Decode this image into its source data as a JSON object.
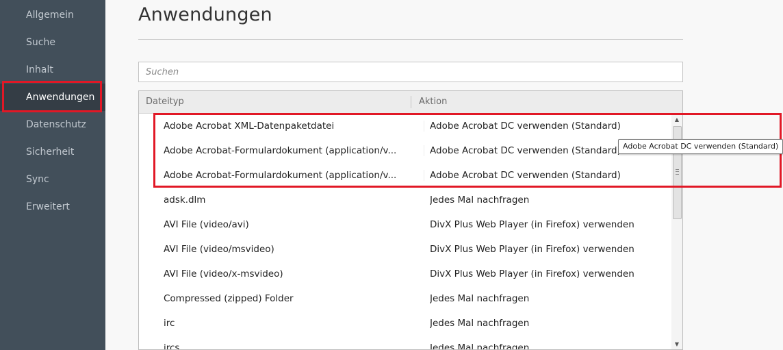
{
  "sidebar": {
    "items": [
      {
        "label": "Allgemein"
      },
      {
        "label": "Suche"
      },
      {
        "label": "Inhalt"
      },
      {
        "label": "Anwendungen"
      },
      {
        "label": "Datenschutz"
      },
      {
        "label": "Sicherheit"
      },
      {
        "label": "Sync"
      },
      {
        "label": "Erweitert"
      }
    ],
    "active": "Anwendungen"
  },
  "main": {
    "title": "Anwendungen",
    "search": {
      "placeholder": "Suchen",
      "value": ""
    },
    "table": {
      "columns": [
        "Dateityp",
        "Aktion"
      ],
      "rows": [
        {
          "type": "Adobe Acrobat XML-Datenpaketdatei",
          "action": "Adobe Acrobat DC  verwenden (Standard)"
        },
        {
          "type": "Adobe Acrobat-Formulardokument (application/v...",
          "action": "Adobe Acrobat DC  verwenden (Standard)"
        },
        {
          "type": "Adobe Acrobat-Formulardokument (application/v...",
          "action": "Adobe Acrobat DC  verwenden (Standard)"
        },
        {
          "type": "adsk.dlm",
          "action": "Jedes Mal nachfragen"
        },
        {
          "type": "AVI File (video/avi)",
          "action": "DivX Plus Web Player (in Firefox) verwenden"
        },
        {
          "type": "AVI File (video/msvideo)",
          "action": "DivX Plus Web Player (in Firefox) verwenden"
        },
        {
          "type": "AVI File (video/x-msvideo)",
          "action": "DivX Plus Web Player (in Firefox) verwenden"
        },
        {
          "type": "Compressed (zipped) Folder",
          "action": "Jedes Mal nachfragen"
        },
        {
          "type": "irc",
          "action": "Jedes Mal nachfragen"
        },
        {
          "type": "ircs",
          "action": "Jedes Mal nachfragen"
        }
      ]
    },
    "tooltip": "Adobe Acrobat DC  verwenden (Standard)"
  },
  "colors": {
    "sidebar_bg": "#424f5a",
    "sidebar_active_bg": "#343d45",
    "highlight_red": "#e11826"
  },
  "icons": {
    "scroll_up": "triangle-up-icon",
    "scroll_down": "triangle-down-icon",
    "scroll_grip": "grip-lines-icon"
  }
}
